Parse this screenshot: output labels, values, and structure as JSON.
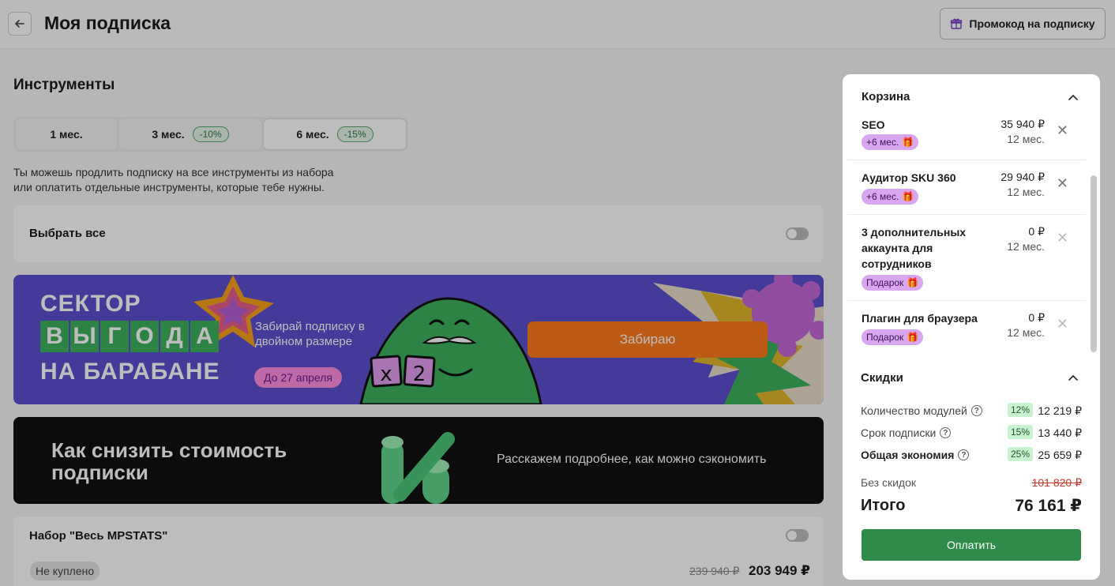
{
  "header": {
    "title": "Моя подписка",
    "promo_label": "Промокод на подписку"
  },
  "tools": {
    "title": "Инструменты",
    "periods": [
      {
        "label": "1 мес.",
        "discount": ""
      },
      {
        "label": "3 мес.",
        "discount": "-10%"
      },
      {
        "label": "6 мес.",
        "discount": "-15%",
        "selected": true
      }
    ],
    "description_line1": "Ты можешь продлить подписку на все инструменты из набора",
    "description_line2": "или оплатить отдельные инструменты, которые тебе нужны.",
    "select_all_label": "Выбрать все"
  },
  "banner": {
    "line1": "СЕКТОР",
    "line2_letters": [
      "В",
      "Ы",
      "Г",
      "О",
      "Д",
      "А"
    ],
    "line3": "НА БАРАБАНЕ",
    "subtitle": "Забирай подписку в двойном размере",
    "date_badge": "До 27 апреля",
    "cta_label": "Забираю",
    "tile_x": "x",
    "tile_2": "2",
    "colors": {
      "bg": "#5b4fcf",
      "tile": "#3db15b",
      "cta": "#ff7a1a",
      "date": "#ff8ee0"
    }
  },
  "promo2": {
    "title_line1": "Как снизить стоимость",
    "title_line2": "подписки",
    "subtitle": "Расскажем подробнее, как можно сэкономить"
  },
  "bundle": {
    "title": "Набор \"Весь MPSTATS\"",
    "status": "Не куплено",
    "old_price": "239 940 ₽",
    "new_price": "203 949 ₽"
  },
  "cart": {
    "title": "Корзина",
    "items": [
      {
        "name": "SEO",
        "price": "35 940 ₽",
        "term": "12 мес.",
        "badge": "+6 мес."
      },
      {
        "name": "Аудитор SKU 360",
        "price": "29 940 ₽",
        "term": "12 мес.",
        "badge": "+6 мес."
      },
      {
        "name": "3 дополнительных аккаунта для сотрудников",
        "price": "0 ₽",
        "term": "12 мес.",
        "badge": "Подарок"
      },
      {
        "name": "Плагин для браузера",
        "price": "0 ₽",
        "term": "12 мес.",
        "badge": "Подарок"
      }
    ]
  },
  "discounts": {
    "title": "Скидки",
    "rows": [
      {
        "label": "Количество модулей",
        "pct": "12%",
        "amount": "12 219 ₽"
      },
      {
        "label": "Срок подписки",
        "pct": "15%",
        "amount": "13 440 ₽"
      },
      {
        "label": "Общая экономия",
        "pct": "25%",
        "amount": "25 659 ₽"
      }
    ],
    "no_discount_label": "Без скидок",
    "no_discount_amount": "101 820 ₽",
    "total_label": "Итого",
    "total_amount": "76 161 ₽"
  },
  "pay_label": "Оплатить"
}
